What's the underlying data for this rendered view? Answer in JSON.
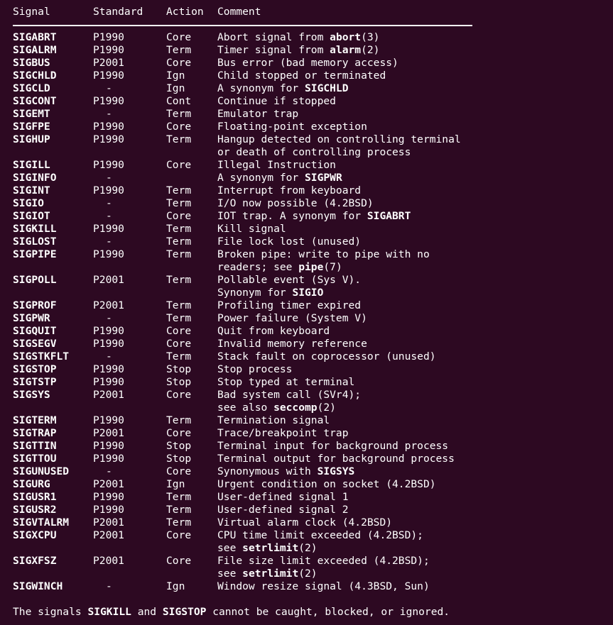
{
  "terminal": {
    "background_color": "#2d0922",
    "foreground_color": "#ffffff",
    "rule_color": "#ffffff"
  },
  "table": {
    "headers": {
      "signal": "Signal",
      "standard": "Standard",
      "action": "Action",
      "comment": "Comment"
    },
    "rows": [
      {
        "signal": "SIGABRT",
        "standard": "P1990",
        "action": "Core",
        "comment_pre": "Abort signal from ",
        "comment_bold": "abort",
        "comment_post": "(3)"
      },
      {
        "signal": "SIGALRM",
        "standard": "P1990",
        "action": "Term",
        "comment_pre": "Timer signal from ",
        "comment_bold": "alarm",
        "comment_post": "(2)"
      },
      {
        "signal": "SIGBUS",
        "standard": "P2001",
        "action": "Core",
        "comment_pre": "Bus error (bad memory access)",
        "comment_bold": "",
        "comment_post": ""
      },
      {
        "signal": "SIGCHLD",
        "standard": "P1990",
        "action": "Ign",
        "comment_pre": "Child stopped or terminated",
        "comment_bold": "",
        "comment_post": ""
      },
      {
        "signal": "SIGCLD",
        "standard": "-",
        "action": "Ign",
        "comment_pre": "A synonym for ",
        "comment_bold": "SIGCHLD",
        "comment_post": ""
      },
      {
        "signal": "SIGCONT",
        "standard": "P1990",
        "action": "Cont",
        "comment_pre": "Continue if stopped",
        "comment_bold": "",
        "comment_post": ""
      },
      {
        "signal": "SIGEMT",
        "standard": "-",
        "action": "Term",
        "comment_pre": "Emulator trap",
        "comment_bold": "",
        "comment_post": ""
      },
      {
        "signal": "SIGFPE",
        "standard": "P1990",
        "action": "Core",
        "comment_pre": "Floating-point exception",
        "comment_bold": "",
        "comment_post": ""
      },
      {
        "signal": "SIGHUP",
        "standard": "P1990",
        "action": "Term",
        "comment_pre": "Hangup detected on controlling terminal",
        "comment_bold": "",
        "comment_post": "",
        "continuation": "or death of controlling process"
      },
      {
        "signal": "SIGILL",
        "standard": "P1990",
        "action": "Core",
        "comment_pre": "Illegal Instruction",
        "comment_bold": "",
        "comment_post": ""
      },
      {
        "signal": "SIGINFO",
        "standard": "-",
        "action": "",
        "comment_pre": "A synonym for ",
        "comment_bold": "SIGPWR",
        "comment_post": ""
      },
      {
        "signal": "SIGINT",
        "standard": "P1990",
        "action": "Term",
        "comment_pre": "Interrupt from keyboard",
        "comment_bold": "",
        "comment_post": ""
      },
      {
        "signal": "SIGIO",
        "standard": "-",
        "action": "Term",
        "comment_pre": "I/O now possible (4.2BSD)",
        "comment_bold": "",
        "comment_post": ""
      },
      {
        "signal": "SIGIOT",
        "standard": "-",
        "action": "Core",
        "comment_pre": "IOT trap. A synonym for ",
        "comment_bold": "SIGABRT",
        "comment_post": ""
      },
      {
        "signal": "SIGKILL",
        "standard": "P1990",
        "action": "Term",
        "comment_pre": "Kill signal",
        "comment_bold": "",
        "comment_post": ""
      },
      {
        "signal": "SIGLOST",
        "standard": "-",
        "action": "Term",
        "comment_pre": "File lock lost (unused)",
        "comment_bold": "",
        "comment_post": ""
      },
      {
        "signal": "SIGPIPE",
        "standard": "P1990",
        "action": "Term",
        "comment_pre": "Broken pipe: write to pipe with no",
        "comment_bold": "",
        "comment_post": "",
        "continuation_pre": "readers; see ",
        "continuation_bold": "pipe",
        "continuation_post": "(7)"
      },
      {
        "signal": "SIGPOLL",
        "standard": "P2001",
        "action": "Term",
        "comment_pre": "Pollable event (Sys V).",
        "comment_bold": "",
        "comment_post": "",
        "continuation_pre": "Synonym for ",
        "continuation_bold": "SIGIO",
        "continuation_post": ""
      },
      {
        "signal": "SIGPROF",
        "standard": "P2001",
        "action": "Term",
        "comment_pre": "Profiling timer expired",
        "comment_bold": "",
        "comment_post": ""
      },
      {
        "signal": "SIGPWR",
        "standard": "-",
        "action": "Term",
        "comment_pre": "Power failure (System V)",
        "comment_bold": "",
        "comment_post": ""
      },
      {
        "signal": "SIGQUIT",
        "standard": "P1990",
        "action": "Core",
        "comment_pre": "Quit from keyboard",
        "comment_bold": "",
        "comment_post": ""
      },
      {
        "signal": "SIGSEGV",
        "standard": "P1990",
        "action": "Core",
        "comment_pre": "Invalid memory reference",
        "comment_bold": "",
        "comment_post": ""
      },
      {
        "signal": "SIGSTKFLT",
        "standard": "-",
        "action": "Term",
        "comment_pre": "Stack fault on coprocessor (unused)",
        "comment_bold": "",
        "comment_post": ""
      },
      {
        "signal": "SIGSTOP",
        "standard": "P1990",
        "action": "Stop",
        "comment_pre": "Stop process",
        "comment_bold": "",
        "comment_post": ""
      },
      {
        "signal": "SIGTSTP",
        "standard": "P1990",
        "action": "Stop",
        "comment_pre": "Stop typed at terminal",
        "comment_bold": "",
        "comment_post": ""
      },
      {
        "signal": "SIGSYS",
        "standard": "P2001",
        "action": "Core",
        "comment_pre": "Bad system call (SVr4);",
        "comment_bold": "",
        "comment_post": "",
        "continuation_pre": "see also ",
        "continuation_bold": "seccomp",
        "continuation_post": "(2)"
      },
      {
        "signal": "SIGTERM",
        "standard": "P1990",
        "action": "Term",
        "comment_pre": "Termination signal",
        "comment_bold": "",
        "comment_post": ""
      },
      {
        "signal": "SIGTRAP",
        "standard": "P2001",
        "action": "Core",
        "comment_pre": "Trace/breakpoint trap",
        "comment_bold": "",
        "comment_post": ""
      },
      {
        "signal": "SIGTTIN",
        "standard": "P1990",
        "action": "Stop",
        "comment_pre": "Terminal input for background process",
        "comment_bold": "",
        "comment_post": ""
      },
      {
        "signal": "SIGTTOU",
        "standard": "P1990",
        "action": "Stop",
        "comment_pre": "Terminal output for background process",
        "comment_bold": "",
        "comment_post": ""
      },
      {
        "signal": "SIGUNUSED",
        "standard": "-",
        "action": "Core",
        "comment_pre": "Synonymous with ",
        "comment_bold": "SIGSYS",
        "comment_post": ""
      },
      {
        "signal": "SIGURG",
        "standard": "P2001",
        "action": "Ign",
        "comment_pre": "Urgent condition on socket (4.2BSD)",
        "comment_bold": "",
        "comment_post": ""
      },
      {
        "signal": "SIGUSR1",
        "standard": "P1990",
        "action": "Term",
        "comment_pre": "User-defined signal 1",
        "comment_bold": "",
        "comment_post": ""
      },
      {
        "signal": "SIGUSR2",
        "standard": "P1990",
        "action": "Term",
        "comment_pre": "User-defined signal 2",
        "comment_bold": "",
        "comment_post": ""
      },
      {
        "signal": "SIGVTALRM",
        "standard": "P2001",
        "action": "Term",
        "comment_pre": "Virtual alarm clock (4.2BSD)",
        "comment_bold": "",
        "comment_post": ""
      },
      {
        "signal": "SIGXCPU",
        "standard": "P2001",
        "action": "Core",
        "comment_pre": "CPU time limit exceeded (4.2BSD);",
        "comment_bold": "",
        "comment_post": "",
        "continuation_pre": "see ",
        "continuation_bold": "setrlimit",
        "continuation_post": "(2)"
      },
      {
        "signal": "SIGXFSZ",
        "standard": "P2001",
        "action": "Core",
        "comment_pre": "File size limit exceeded (4.2BSD);",
        "comment_bold": "",
        "comment_post": "",
        "continuation_pre": "see ",
        "continuation_bold": "setrlimit",
        "continuation_post": "(2)"
      },
      {
        "signal": "SIGWINCH",
        "standard": "-",
        "action": "Ign",
        "comment_pre": "Window resize signal (4.3BSD, Sun)",
        "comment_bold": "",
        "comment_post": ""
      }
    ]
  },
  "footer": {
    "pre": "The signals ",
    "bold1": "SIGKILL",
    "mid": " and ",
    "bold2": "SIGSTOP",
    "post": " cannot be caught, blocked, or ignored."
  }
}
